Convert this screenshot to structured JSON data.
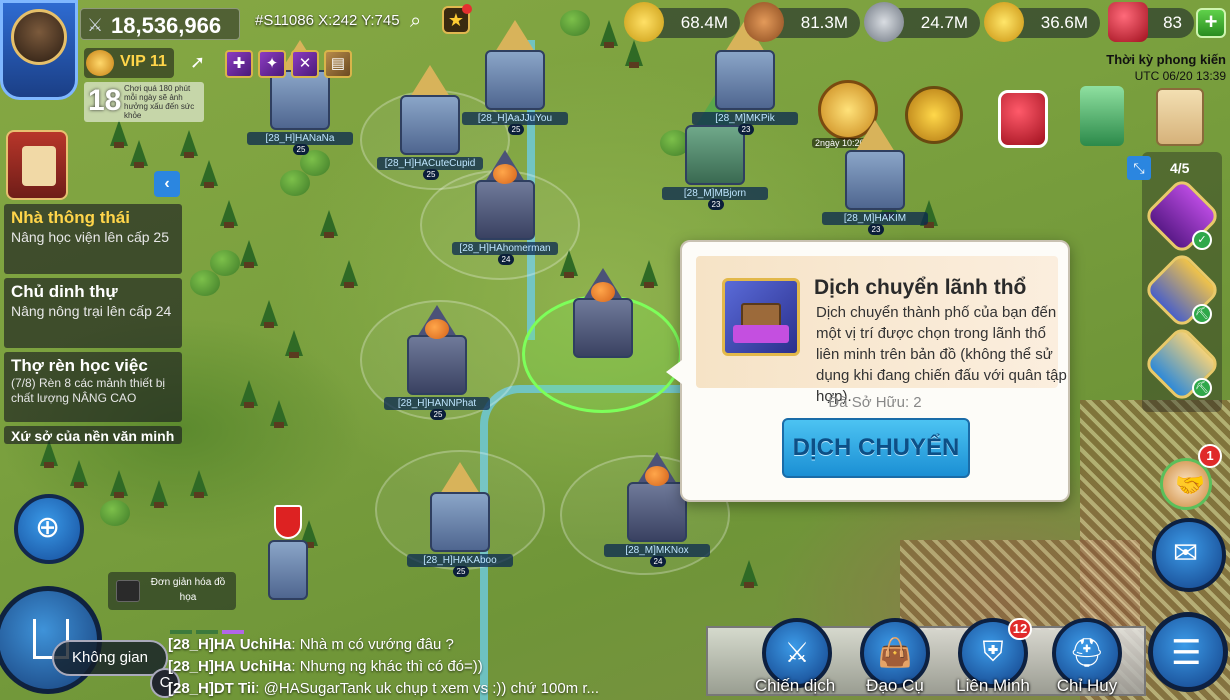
{
  "player": {
    "power": "18,536,966",
    "coords": "#S11086 X:242 Y:745",
    "vip": "VIP 11",
    "age_rating": "18",
    "age_warning": "Chơi quá 180 phút mỗi ngày sẽ ảnh hưởng xấu đến sức khỏe"
  },
  "resources": [
    {
      "name": "food",
      "icon": "corn-icon",
      "value": "68.4M",
      "color": "#f2c23a"
    },
    {
      "name": "wood",
      "icon": "log-icon",
      "value": "81.3M",
      "color": "#b8693a"
    },
    {
      "name": "stone",
      "icon": "stone-icon",
      "value": "24.7M",
      "color": "#9aa3ad"
    },
    {
      "name": "gold",
      "icon": "gold-coin-icon",
      "value": "36.6M",
      "color": "#f3c320"
    },
    {
      "name": "gems",
      "icon": "gem-icon",
      "value": "83",
      "color": "#e02a3a"
    }
  ],
  "era": "Thời kỳ phong kiến",
  "utc": "UTC 06/20 13:39",
  "quests": [
    {
      "title": "Nhà thông thái",
      "desc": "Nâng học viện lên cấp 25"
    },
    {
      "title": "Chủ dinh thự",
      "desc": "Nâng nông trại lên cấp 24"
    },
    {
      "title": "Thợ rèn học việc",
      "desc": "(7/8) Rèn 8 các mảnh thiết bị chất lượng NÂNG CAO"
    },
    {
      "title": "Xứ sở của nền văn minh"
    }
  ],
  "commanders": {
    "count": "4/5"
  },
  "popup": {
    "title": "Dịch chuyển lãnh thổ",
    "desc": "Dịch chuyển thành phố của bạn đến một vị trí được chọn trong lãnh thổ liên minh trên bản đồ (không thể sử dụng khi đang chiến đấu với quân tập hợp).",
    "owned": "Đã Sở Hữu: 2",
    "button": "DỊCH CHUYỂN"
  },
  "map": {
    "cities": [
      {
        "tag": "[28_H]AaJJuYou",
        "lvl": "25"
      },
      {
        "tag": "[28_H]HANaNa",
        "lvl": "25"
      },
      {
        "tag": "[28_H]HACuteCupid",
        "lvl": "25"
      },
      {
        "tag": "[28_M]MBjorn",
        "lvl": "23"
      },
      {
        "tag": "[28_H]HAhomerman",
        "lvl": "24"
      },
      {
        "tag": "[28_M]HAKIM",
        "lvl": "23"
      },
      {
        "tag": "[28_H]HANNPhat",
        "lvl": "25"
      },
      {
        "tag": "[28_H]HAKAboo",
        "lvl": "25"
      },
      {
        "tag": "[28_M]MKNox",
        "lvl": "24"
      },
      {
        "tag": "[28_M]MKPik",
        "lvl": "23"
      }
    ],
    "event_timer": "2ngày 10:20:29"
  },
  "simplify_label": "Đơn giản hóa đồ họa",
  "space_label": "Không gian",
  "chat_c": "C",
  "chat": [
    {
      "tag": "[28_H]HA",
      "user": "UchiHa",
      "msg": ": Nhà m có vướng đâu ?"
    },
    {
      "tag": "[28_H]HA",
      "user": "UchiHa",
      "msg": ": Nhưng ng khác thì có đó=))"
    },
    {
      "tag": "[28_H]DT",
      "user": "Tii",
      "msg": ": @HASugarTank  uk chụp t xem vs :)) chứ 100m r..."
    }
  ],
  "nav": [
    {
      "label": "Chiến dịch",
      "icon": "crossed-swords-icon"
    },
    {
      "label": "Đạo Cụ",
      "icon": "bag-icon"
    },
    {
      "label": "Liên Minh",
      "icon": "shield-icon",
      "badge": "12"
    },
    {
      "label": "Chỉ Huy",
      "icon": "helmet-icon"
    }
  ],
  "help_badge": "1"
}
